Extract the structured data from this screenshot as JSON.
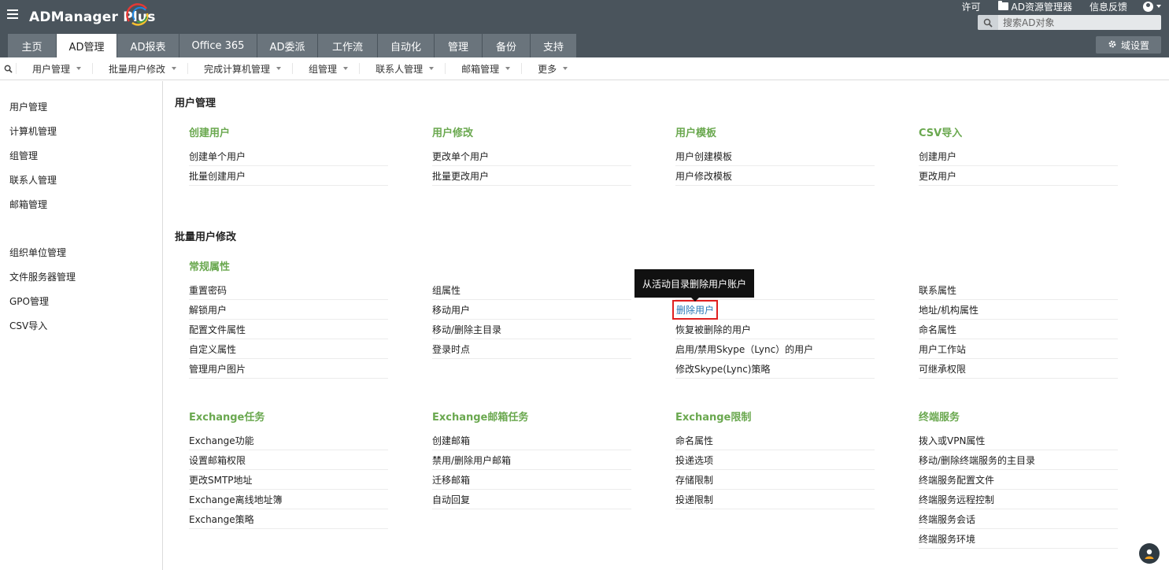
{
  "app": {
    "logo_text": "ADManager Plus"
  },
  "top_links": {
    "license": "许可",
    "ad_explorer": "AD资源管理器",
    "feedback": "信息反馈"
  },
  "search": {
    "placeholder": "搜索AD对象"
  },
  "nav_tabs": [
    {
      "label": "主页",
      "active": false
    },
    {
      "label": "AD管理",
      "active": true
    },
    {
      "label": "AD报表",
      "active": false
    },
    {
      "label": "Office 365",
      "active": false
    },
    {
      "label": "AD委派",
      "active": false
    },
    {
      "label": "工作流",
      "active": false
    },
    {
      "label": "自动化",
      "active": false
    },
    {
      "label": "管理",
      "active": false
    },
    {
      "label": "备份",
      "active": false
    },
    {
      "label": "支持",
      "active": false
    }
  ],
  "domain_settings_label": "域设置",
  "subbar": [
    "用户管理",
    "批量用户修改",
    "完成计算机管理",
    "组管理",
    "联系人管理",
    "邮箱管理",
    "更多"
  ],
  "sidebar": {
    "items": [
      "用户管理",
      "计算机管理",
      "组管理",
      "联系人管理",
      "邮箱管理",
      "组织单位管理",
      "文件服务器管理",
      "GPO管理",
      "CSV导入"
    ]
  },
  "sections": [
    {
      "title": "用户管理",
      "groups": [
        {
          "title": "创建用户",
          "links": [
            "创建单个用户",
            "批量创建用户"
          ]
        },
        {
          "title": "用户修改",
          "links": [
            "更改单个用户",
            "批量更改用户"
          ]
        },
        {
          "title": "用户模板",
          "links": [
            "用户创建模板",
            "用户修改模板"
          ]
        },
        {
          "title": "CSV导入",
          "links": [
            "创建用户",
            "更改用户"
          ]
        }
      ]
    },
    {
      "title": "批量用户修改",
      "groups": [
        {
          "title": "常规属性",
          "columns": [
            [
              "重置密码",
              "解锁用户",
              "配置文件属性",
              "自定义属性",
              "管理用户图片"
            ],
            [
              "组属性",
              "移动用户",
              "移动/删除主目录",
              "登录时点"
            ],
            [
              "",
              "删除用户",
              "恢复被删除的用户",
              "启用/禁用Skype（Lync）的用户",
              "修改Skype(Lync)策略"
            ],
            [
              "联系属性",
              "地址/机构属性",
              "命名属性",
              "用户工作站",
              "可继承权限"
            ]
          ]
        },
        {
          "title": "Exchange任务",
          "links": [
            "Exchange功能",
            "设置邮箱权限",
            "更改SMTP地址",
            "Exchange离线地址簿",
            "Exchange策略"
          ]
        },
        {
          "title": "Exchange邮箱任务",
          "links": [
            "创建邮箱",
            "禁用/删除用户邮箱",
            "迁移邮箱",
            "自动回复"
          ]
        },
        {
          "title": "Exchange限制",
          "links": [
            "命名属性",
            "投递选项",
            "存储限制",
            "投递限制"
          ]
        },
        {
          "title": "终端服务",
          "links": [
            "拨入或VPN属性",
            "移动/删除终端服务的主目录",
            "终端服务配置文件",
            "终端服务远程控制",
            "终端服务会话",
            "终端服务环境"
          ]
        }
      ]
    }
  ],
  "tooltip_text": "从活动目录删除用户账户",
  "colors": {
    "header_bg": "#4a545c",
    "tab_bg": "#6a747c",
    "group_title": "#6aa84f",
    "link_selected": "#2a7ab8",
    "highlight_border": "#e02020"
  }
}
